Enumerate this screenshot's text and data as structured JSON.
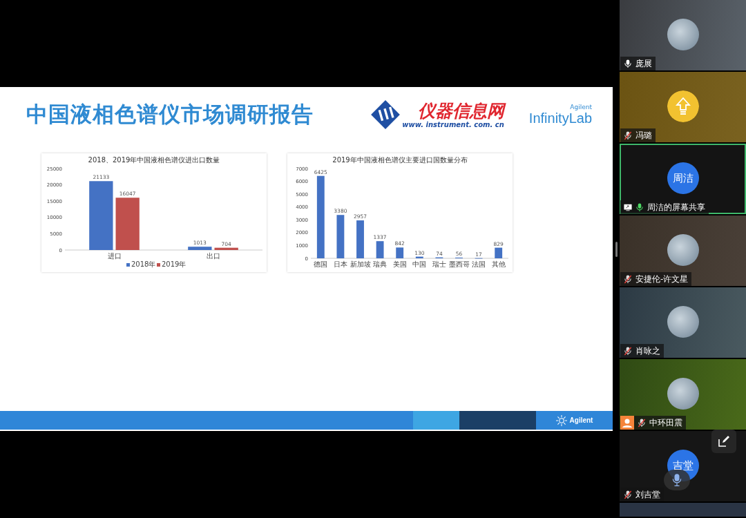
{
  "slide": {
    "title": "中国液相色谱仪市场调研报告",
    "logo_main": {
      "text": "仪器信息网",
      "url": "www. instrument. com. cn"
    },
    "logo_side": {
      "brand": "Agilent",
      "product": "InfinityLab"
    },
    "charts": [
      {
        "chart_data": {
          "type": "bar",
          "title": "2018、2019年中国液相色谱仪进出口数量",
          "categories": [
            "进口",
            "出口"
          ],
          "series": [
            {
              "name": "2018年",
              "color": "#4472c4",
              "values": [
                21133,
                1013
              ]
            },
            {
              "name": "2019年",
              "color": "#c0504d",
              "values": [
                16047,
                704
              ]
            }
          ],
          "ylim": [
            0,
            25000
          ],
          "yticks": [
            0,
            5000,
            10000,
            15000,
            20000,
            25000
          ],
          "data_labels": true,
          "legend": "bottom"
        }
      },
      {
        "chart_data": {
          "type": "bar",
          "title": "2019年中国液相色谱仪主要进口国数量分布",
          "categories": [
            "德国",
            "日本",
            "新加坡",
            "瑞典",
            "美国",
            "中国",
            "瑞士",
            "墨西哥",
            "法国",
            "其他"
          ],
          "series": [
            {
              "color": "#4472c4",
              "values": [
                6425,
                3380,
                2957,
                1337,
                842,
                130,
                74,
                56,
                17,
                829
              ]
            }
          ],
          "ylim": [
            0,
            7000
          ],
          "yticks": [
            0,
            1000,
            2000,
            3000,
            4000,
            5000,
            6000,
            7000
          ],
          "data_labels": true
        }
      }
    ],
    "footer": {
      "brand": "Agilent"
    }
  },
  "participants": [
    {
      "name": "庞展",
      "muted": false,
      "avatar": {
        "kind": "photo"
      },
      "sharing": false,
      "person_badge": false,
      "selected": false
    },
    {
      "name": "冯璐",
      "muted": true,
      "avatar": {
        "kind": "icon"
      },
      "sharing": false,
      "person_badge": false,
      "selected": false
    },
    {
      "name": "周洁的屏幕共享",
      "muted": false,
      "avatar": {
        "kind": "initials",
        "text": "周洁"
      },
      "sharing": true,
      "person_badge": false,
      "selected": true
    },
    {
      "name": "安捷伦-许文星",
      "muted": true,
      "avatar": {
        "kind": "photo"
      },
      "sharing": false,
      "person_badge": false,
      "selected": false
    },
    {
      "name": "肖咏之",
      "muted": true,
      "avatar": {
        "kind": "photo"
      },
      "sharing": false,
      "person_badge": false,
      "selected": false
    },
    {
      "name": "中环田震",
      "muted": true,
      "avatar": {
        "kind": "photo"
      },
      "sharing": false,
      "person_badge": true,
      "selected": false
    },
    {
      "name": "刘吉堂",
      "muted": true,
      "avatar": {
        "kind": "initials",
        "text": "吉堂"
      },
      "sharing": false,
      "person_badge": false,
      "selected": false
    }
  ]
}
